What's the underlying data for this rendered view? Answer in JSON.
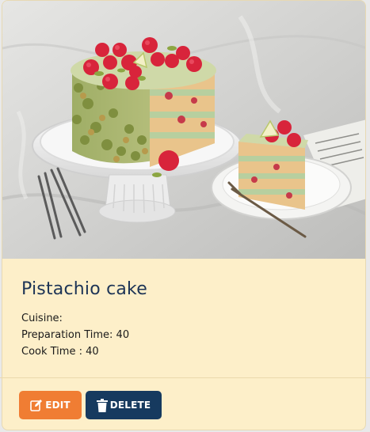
{
  "recipe": {
    "title": "Pistachio cake",
    "cuisine_label": "Cuisine:",
    "prep_label": "Preparation Time: 40",
    "cook_label": "Cook Time : 40"
  },
  "actions": {
    "edit_label": "EDIT",
    "delete_label": "DELETE"
  },
  "icons": {
    "edit": "edit-icon",
    "delete": "trash-icon"
  },
  "colors": {
    "card_background": "#fdefc9",
    "title": "#1d3456",
    "edit_button": "#f07d33",
    "delete_button": "#163a5f"
  }
}
